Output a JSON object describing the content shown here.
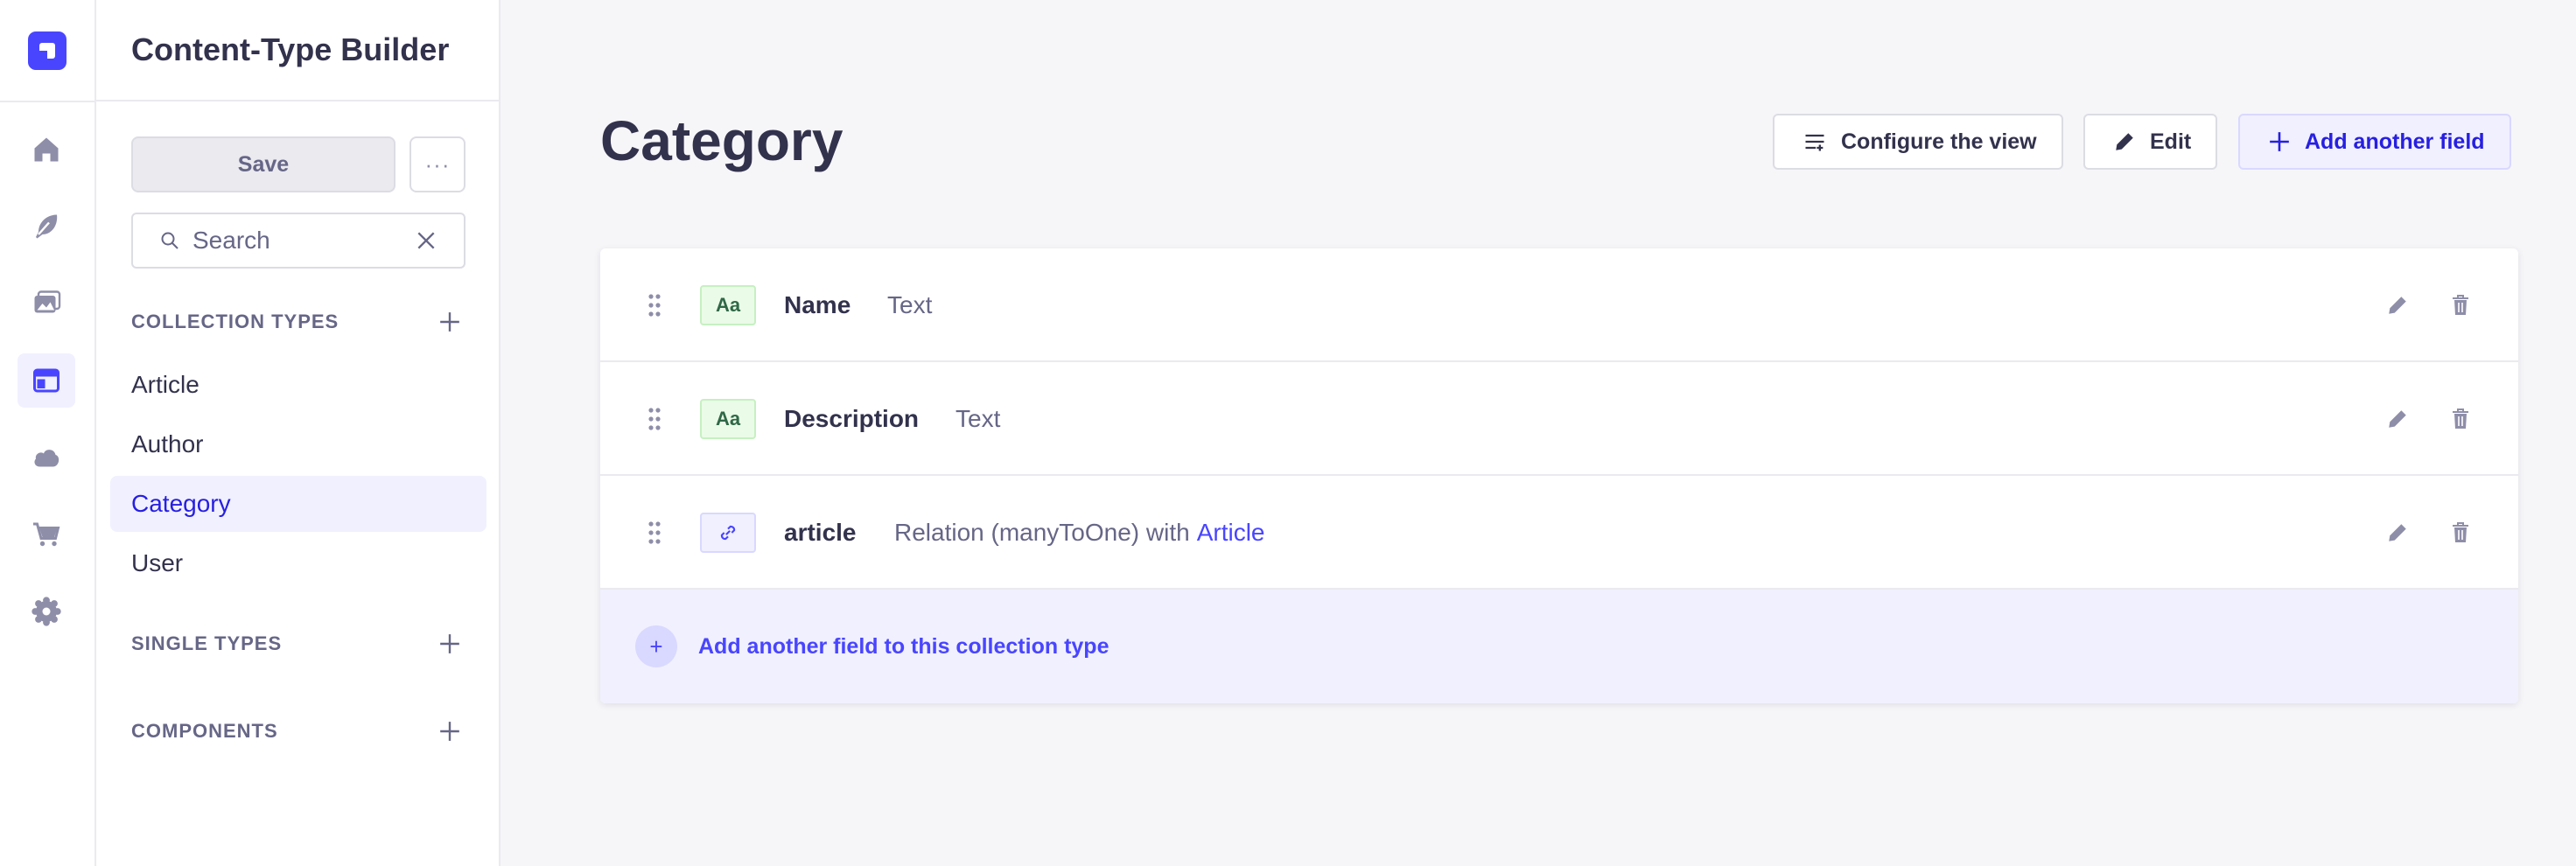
{
  "app": {
    "name": "Content-Type Builder"
  },
  "rail": {
    "items": [
      {
        "icon": "house-icon",
        "label": "Home"
      },
      {
        "icon": "feather-icon",
        "label": "Content Manager"
      },
      {
        "icon": "image-icon",
        "label": "Media Library"
      },
      {
        "icon": "layout-icon",
        "label": "Content-Type Builder",
        "active": true
      },
      {
        "icon": "cloud-icon",
        "label": "Deploy"
      },
      {
        "icon": "cart-icon",
        "label": "Marketplace"
      },
      {
        "icon": "gear-icon",
        "label": "Settings"
      }
    ]
  },
  "sidebar": {
    "save_label": "Save",
    "more_label": "···",
    "search": {
      "placeholder": "Search",
      "value": ""
    },
    "collection_types": {
      "heading": "COLLECTION TYPES",
      "items": [
        {
          "label": "Article"
        },
        {
          "label": "Author"
        },
        {
          "label": "Category",
          "active": true
        },
        {
          "label": "User"
        }
      ]
    },
    "single_types": {
      "heading": "SINGLE TYPES"
    },
    "components": {
      "heading": "COMPONENTS"
    }
  },
  "main": {
    "title": "Category",
    "buttons": {
      "configure": "Configure the view",
      "edit": "Edit",
      "add_field": "Add another field"
    },
    "fields": [
      {
        "name": "Name",
        "type": "Text",
        "badge": "Aa",
        "kind": "text"
      },
      {
        "name": "Description",
        "type": "Text",
        "badge": "Aa",
        "kind": "text"
      },
      {
        "name": "article",
        "type": "Relation (manyToOne) with",
        "target": "Article",
        "kind": "relation"
      }
    ],
    "add_field_row_label": "Add another field to this collection type"
  },
  "colors": {
    "accent": "#4945ff",
    "accent_light": "#f0f0ff",
    "text_badge_bg": "#eafbe7",
    "text_primary": "#32324d",
    "text_muted": "#666687"
  }
}
